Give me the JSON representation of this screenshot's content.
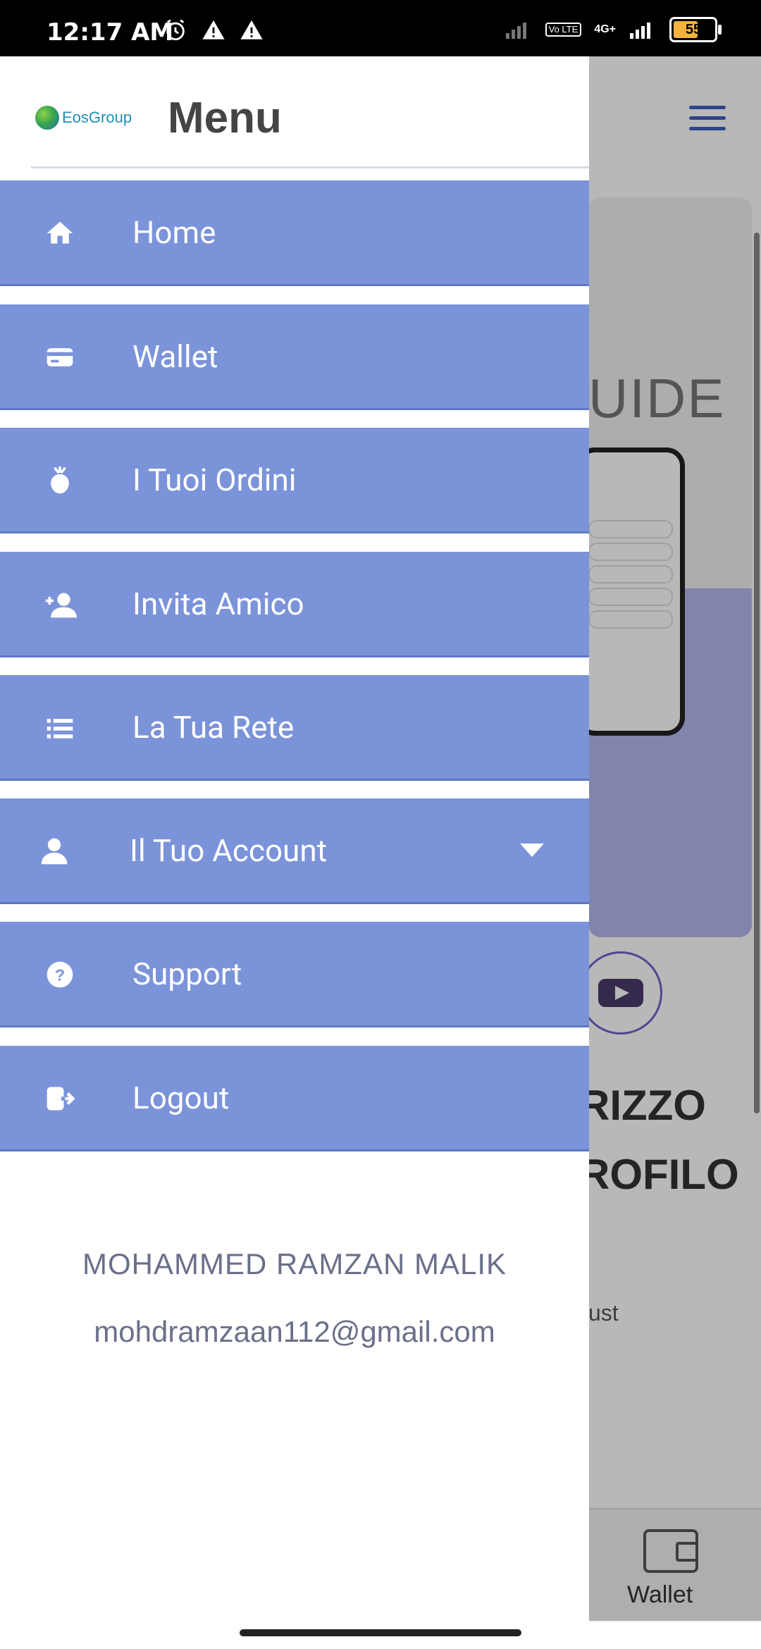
{
  "status_bar": {
    "time": "12:17 AM",
    "battery": "55",
    "network": "4G+",
    "volte": "Vo LTE"
  },
  "drawer": {
    "brand": "EosGroup",
    "title": "Menu",
    "items": [
      {
        "label": "Home",
        "icon": "home-icon"
      },
      {
        "label": "Wallet",
        "icon": "card-icon"
      },
      {
        "label": "I Tuoi Ordini",
        "icon": "rose-icon"
      },
      {
        "label": "Invita Amico",
        "icon": "add-person-icon"
      },
      {
        "label": "La Tua Rete",
        "icon": "list-icon"
      },
      {
        "label": "Il Tuo Account",
        "icon": "person-icon"
      },
      {
        "label": "Support",
        "icon": "help-icon"
      },
      {
        "label": "Logout",
        "icon": "logout-icon"
      }
    ],
    "user": {
      "name": "MOHAMMED RAMZAN MALIK",
      "email": "mohdramzaan112@gmail.com"
    }
  },
  "background": {
    "guide_text": "UIDE",
    "heading_line1": "RIZZO",
    "heading_line2": "ROFILO",
    "body_fragment": "ust",
    "bottom_tab_label": "Wallet"
  },
  "colors": {
    "menu_item_bg": "#7b93d9",
    "accent": "#3f5fc0",
    "text_muted": "#6b6f8a"
  }
}
